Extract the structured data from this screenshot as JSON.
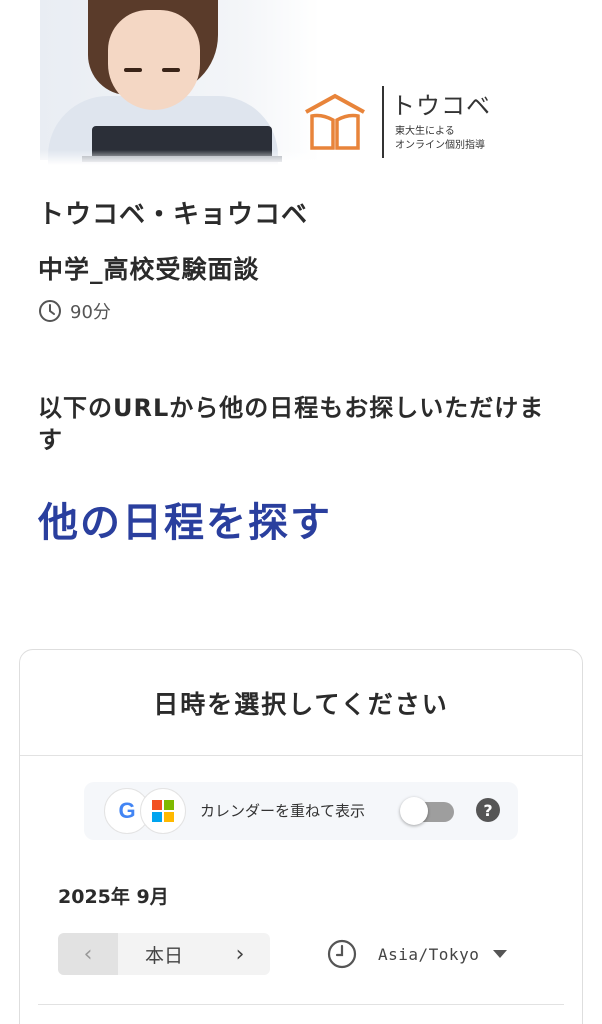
{
  "header": {
    "logo_name": "トウコベ",
    "logo_sub1": "東大生による",
    "logo_sub2": "オンライン個別指導"
  },
  "event": {
    "organizer": "トウコベ・キョウコベ",
    "title": "中学_高校受験面談",
    "duration": "90分"
  },
  "notice": {
    "text": "以下のURLから他の日程もお探しいただけます",
    "link_label": "他の日程を探す"
  },
  "picker": {
    "heading": "日時を選択してください",
    "calendar_overlay_label": "カレンダーを重ねて表示",
    "calendar_overlay_enabled": false,
    "help_label": "?",
    "month": "2025年 9月",
    "today_label": "本日",
    "prev_label": "‹",
    "next_label": "›",
    "timezone": "Asia/Tokyo"
  },
  "colors": {
    "link": "#2a3f9e",
    "logo_orange": "#e8843a"
  }
}
